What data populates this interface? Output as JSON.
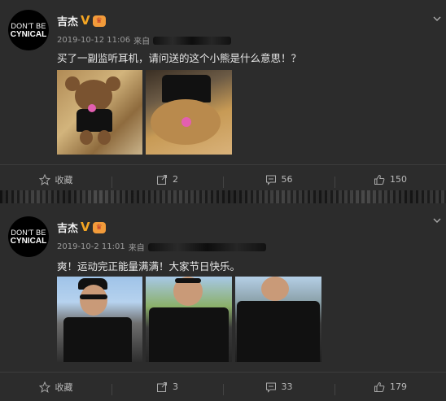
{
  "posts": [
    {
      "avatar": {
        "line1": "DON'T BE",
        "line2": "CYNICAL"
      },
      "author": "吉杰",
      "verified_glyph": "V",
      "timestamp": "2019-10-12 11:06",
      "source_prefix": "来自",
      "text": "买了一副监听耳机，请问送的这个小熊是什么意思！？",
      "actions": {
        "favorite": "收藏",
        "repost": "2",
        "comment": "56",
        "like": "150"
      }
    },
    {
      "avatar": {
        "line1": "DON'T BE",
        "line2": "CYNICAL"
      },
      "author": "吉杰",
      "verified_glyph": "V",
      "timestamp": "2019-10-2 11:01",
      "source_prefix": "来自",
      "text": "爽！运动完正能量满满！大家节日快乐。",
      "actions": {
        "favorite": "收藏",
        "repost": "3",
        "comment": "33",
        "like": "179"
      }
    }
  ],
  "icons": {
    "favorite": "star-icon",
    "repost": "share-icon",
    "comment": "comment-icon",
    "like": "thumbs-up-icon",
    "menu": "chevron-down-icon"
  },
  "colors": {
    "background": "#2c2c2c",
    "verified": "#f5a623",
    "text": "#e8e8e8",
    "muted": "#9a9a9a"
  }
}
